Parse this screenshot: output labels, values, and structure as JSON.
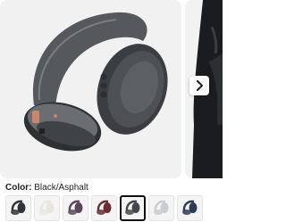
{
  "product": {
    "color_label": "Color:",
    "color_value": "Black/Asphalt"
  },
  "gallery": {
    "next_icon": "chevron-right-icon"
  },
  "swatches": [
    {
      "name": "Black/Asphalt dark",
      "color": "#2f3236",
      "selected": false
    },
    {
      "name": "White/Cream",
      "color": "#e9e6df",
      "selected": false
    },
    {
      "name": "Purple",
      "color": "#5a4658",
      "selected": false
    },
    {
      "name": "Maroon",
      "color": "#6b2d33",
      "selected": false
    },
    {
      "name": "Black/Asphalt",
      "color": "#44484d",
      "selected": true
    },
    {
      "name": "Light Grey",
      "color": "#c9ccd0",
      "selected": false
    },
    {
      "name": "Navy",
      "color": "#2d3a58",
      "selected": false
    }
  ]
}
